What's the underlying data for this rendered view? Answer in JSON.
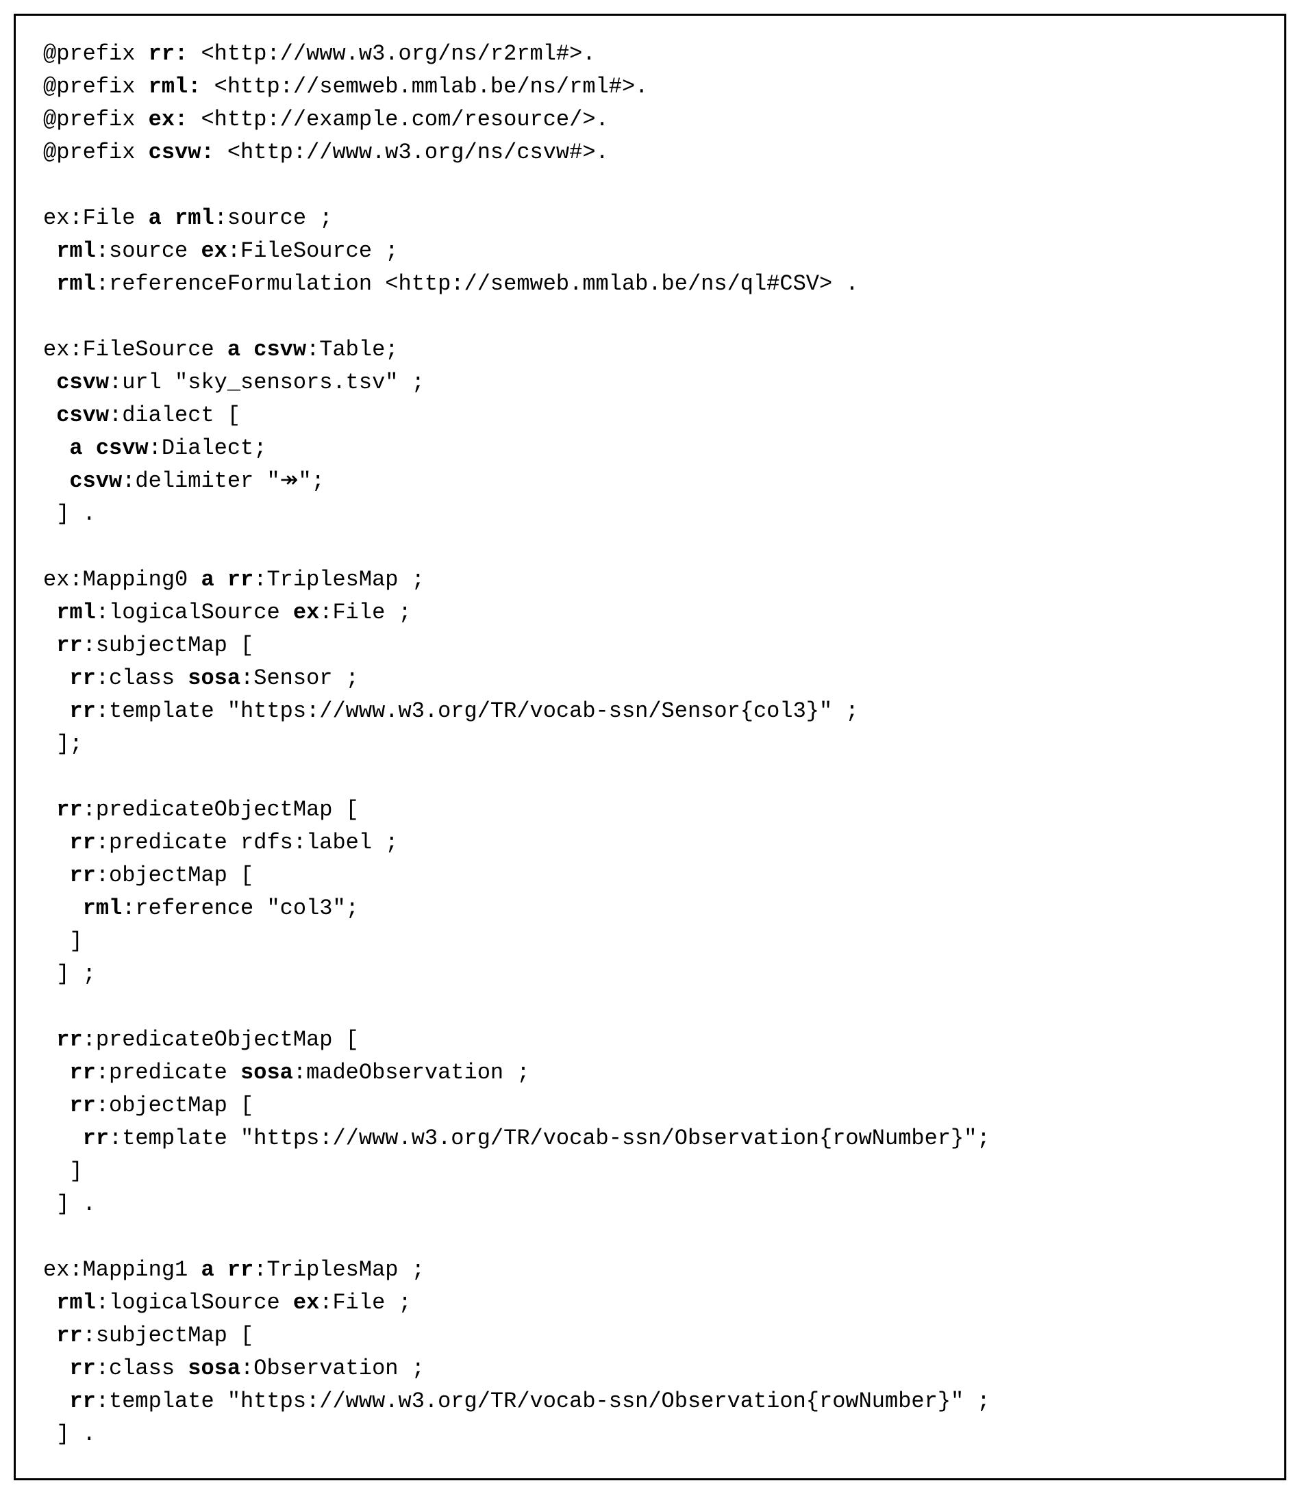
{
  "code": {
    "l1": {
      "kw1": "rr:",
      "rest": " <http://www.w3.org/ns/r2rml#>."
    },
    "l2": {
      "kw1": "rml:",
      "rest": " <http://semweb.mmlab.be/ns/rml#>."
    },
    "l3": {
      "kw1": "ex:",
      "rest": " <http://example.com/resource/>."
    },
    "l4": {
      "kw1": "csvw:",
      "rest": " <http://www.w3.org/ns/csvw#>."
    },
    "l6": {
      "pre": "ex:File ",
      "kw1": "a",
      "mid1": " ",
      "kw2": "rml",
      "rest": ":source ;"
    },
    "l7": {
      "sp": " ",
      "kw1": "rml",
      "mid": ":source ",
      "kw2": "ex",
      "rest": ":FileSource ;"
    },
    "l8": {
      "sp": " ",
      "kw1": "rml",
      "rest": ":referenceFormulation <http://semweb.mmlab.be/ns/ql#CSV> ."
    },
    "l10": {
      "pre": "ex:FileSource ",
      "kw1": "a",
      "mid": " ",
      "kw2": "csvw",
      "rest": ":Table;"
    },
    "l11": {
      "sp": " ",
      "kw1": "csvw",
      "rest": ":url \"sky_sensors.tsv\" ;"
    },
    "l12": {
      "sp": " ",
      "kw1": "csvw",
      "rest": ":dialect ["
    },
    "l13": {
      "sp": "  ",
      "kw1": "a",
      "mid": " ",
      "kw2": "csvw",
      "rest": ":Dialect;"
    },
    "l14": {
      "sp": "  ",
      "kw1": "csvw",
      "rest": ":delimiter \"↠\";"
    },
    "l15": {
      "full": " ] ."
    },
    "l17": {
      "pre": "ex:Mapping0 ",
      "kw1": "a",
      "mid": " ",
      "kw2": "rr",
      "rest": ":TriplesMap ;"
    },
    "l18": {
      "sp": " ",
      "kw1": "rml",
      "mid": ":logicalSource ",
      "kw2": "ex",
      "rest": ":File ;"
    },
    "l19": {
      "sp": " ",
      "kw1": "rr",
      "rest": ":subjectMap ["
    },
    "l20": {
      "sp": "  ",
      "kw1": "rr",
      "mid": ":class ",
      "kw2": "sosa",
      "rest": ":Sensor ;"
    },
    "l21": {
      "sp": "  ",
      "kw1": "rr",
      "rest": ":template \"https://www.w3.org/TR/vocab-ssn/Sensor{col3}\" ;"
    },
    "l22": {
      "full": " ];"
    },
    "l24": {
      "sp": " ",
      "kw1": "rr",
      "rest": ":predicateObjectMap ["
    },
    "l25": {
      "sp": "  ",
      "kw1": "rr",
      "rest": ":predicate rdfs:label ;"
    },
    "l26": {
      "sp": "  ",
      "kw1": "rr",
      "rest": ":objectMap ["
    },
    "l27": {
      "sp": "   ",
      "kw1": "rml",
      "rest": ":reference \"col3\";"
    },
    "l28": {
      "full": "  ]"
    },
    "l29": {
      "full": " ] ;"
    },
    "l31": {
      "sp": " ",
      "kw1": "rr",
      "rest": ":predicateObjectMap ["
    },
    "l32": {
      "sp": "  ",
      "kw1": "rr",
      "mid": ":predicate ",
      "kw2": "sosa",
      "rest": ":madeObservation ;"
    },
    "l33": {
      "sp": "  ",
      "kw1": "rr",
      "rest": ":objectMap ["
    },
    "l34": {
      "sp": "   ",
      "kw1": "rr",
      "rest": ":template \"https://www.w3.org/TR/vocab-ssn/Observation{rowNumber}\";"
    },
    "l35": {
      "full": "  ]"
    },
    "l36": {
      "full": " ] ."
    },
    "l38": {
      "pre": "ex:Mapping1 ",
      "kw1": "a",
      "mid": " ",
      "kw2": "rr",
      "rest": ":TriplesMap ;"
    },
    "l39": {
      "sp": " ",
      "kw1": "rml",
      "mid": ":logicalSource ",
      "kw2": "ex",
      "rest": ":File ;"
    },
    "l40": {
      "sp": " ",
      "kw1": "rr",
      "rest": ":subjectMap ["
    },
    "l41": {
      "sp": "  ",
      "kw1": "rr",
      "mid": ":class ",
      "kw2": "sosa",
      "rest": ":Observation ;"
    },
    "l42": {
      "sp": "  ",
      "kw1": "rr",
      "rest": ":template \"https://www.w3.org/TR/vocab-ssn/Observation{rowNumber}\" ;"
    },
    "l43": {
      "full": " ] ."
    }
  },
  "prefix_lead": "@prefix "
}
